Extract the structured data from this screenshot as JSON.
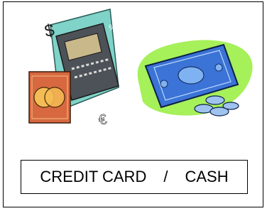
{
  "label": {
    "credit": "CREDIT CARD",
    "separator": "/",
    "cash": "CASH"
  },
  "clipart": {
    "dollar_sign": "$",
    "euro_sign": "€"
  },
  "colors": {
    "card_panel": "#7fd3c8",
    "card_body": "#4d5258",
    "chip_card": "#d7683f",
    "chip_yellow": "#f4bc55",
    "cash_blob": "#a6f05a",
    "banknote": "#3b73d6",
    "banknote_light": "#7fb2f2",
    "coin": "#9fc3ee"
  }
}
